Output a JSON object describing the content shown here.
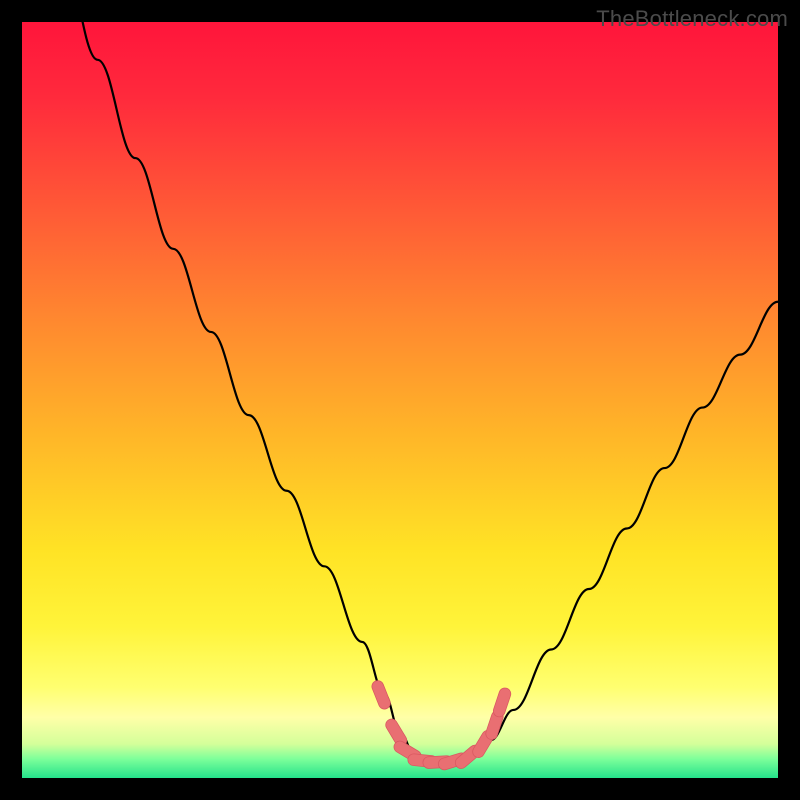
{
  "watermark": "TheBottleneck.com",
  "colors": {
    "frame": "#000000",
    "gradient_stops": [
      {
        "offset": 0.0,
        "color": "#ff153b"
      },
      {
        "offset": 0.1,
        "color": "#ff2a3c"
      },
      {
        "offset": 0.25,
        "color": "#ff5a36"
      },
      {
        "offset": 0.4,
        "color": "#ff8a2f"
      },
      {
        "offset": 0.55,
        "color": "#ffb728"
      },
      {
        "offset": 0.7,
        "color": "#ffe325"
      },
      {
        "offset": 0.8,
        "color": "#fff43a"
      },
      {
        "offset": 0.88,
        "color": "#ffff70"
      },
      {
        "offset": 0.92,
        "color": "#ffffa8"
      },
      {
        "offset": 0.955,
        "color": "#d4ff9a"
      },
      {
        "offset": 0.975,
        "color": "#7cff9a"
      },
      {
        "offset": 1.0,
        "color": "#25e28b"
      }
    ],
    "curve": "#000000",
    "marker_fill": "#e96f72",
    "marker_stroke": "#d95860"
  },
  "chart_data": {
    "type": "line",
    "title": "",
    "xlabel": "",
    "ylabel": "",
    "xlim": [
      0,
      100
    ],
    "ylim": [
      0,
      100
    ],
    "series": [
      {
        "name": "bottleneck-curve",
        "x": [
          0,
          5,
          10,
          15,
          20,
          25,
          30,
          35,
          40,
          45,
          48,
          50,
          52,
          54,
          56,
          58,
          60,
          62,
          65,
          70,
          75,
          80,
          85,
          90,
          95,
          100
        ],
        "y": [
          125,
          110,
          95,
          82,
          70,
          59,
          48,
          38,
          28,
          18,
          11,
          6,
          3,
          2,
          2,
          2,
          3,
          5,
          9,
          17,
          25,
          33,
          41,
          49,
          56,
          63
        ]
      }
    ],
    "markers": {
      "name": "highlight-points",
      "x": [
        47.5,
        49.5,
        51,
        53,
        55,
        57,
        59,
        61,
        62.5,
        63.5
      ],
      "y": [
        11,
        6,
        3.5,
        2.3,
        2.1,
        2.2,
        2.8,
        4.5,
        7,
        10
      ]
    }
  }
}
